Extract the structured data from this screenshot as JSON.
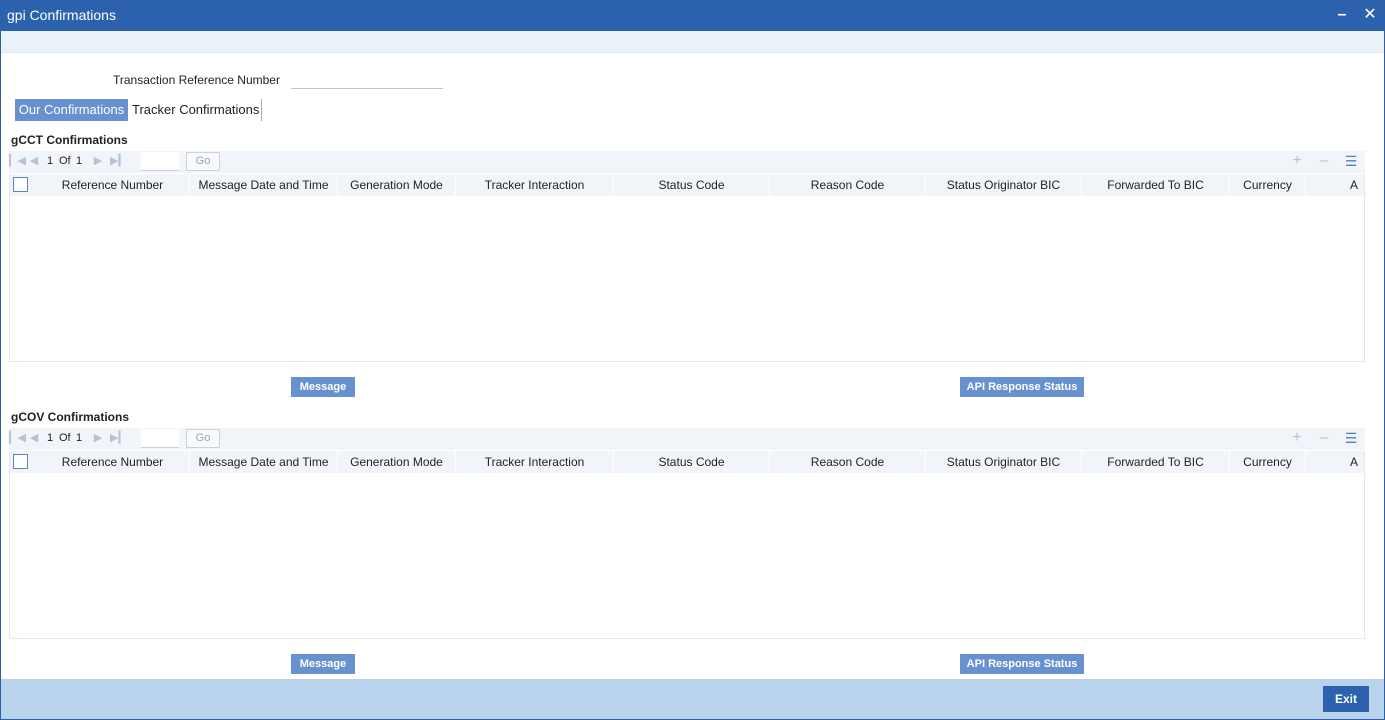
{
  "window": {
    "title": "gpi Confirmations",
    "minimize_symbol": "–",
    "close_symbol": "✕"
  },
  "form": {
    "transaction_reference_label": "Transaction Reference Number",
    "transaction_reference_value": ""
  },
  "tabs": [
    {
      "label": "Our Confirmations",
      "active": true
    },
    {
      "label": "Tracker Confirmations",
      "active": false
    }
  ],
  "columns": [
    "Reference Number",
    "Message Date and Time",
    "Generation Mode",
    "Tracker Interaction",
    "Status Code",
    "Reason Code",
    "Status Originator BIC",
    "Forwarded To BIC",
    "Currency",
    "A"
  ],
  "sections": {
    "gcct": {
      "title": "gCCT Confirmations",
      "pager": {
        "current": "1",
        "of_label": "Of",
        "total": "1",
        "go_label": "Go"
      },
      "message_button": "Message",
      "api_button": "API Response Status"
    },
    "gcov": {
      "title": "gCOV Confirmations",
      "pager": {
        "current": "1",
        "of_label": "Of",
        "total": "1",
        "go_label": "Go"
      },
      "message_button": "Message",
      "api_button": "API Response Status"
    }
  },
  "icons": {
    "first_page": "first-page-icon",
    "prev_page": "previous-page-icon",
    "next_page": "next-page-icon",
    "last_page": "last-page-icon",
    "add_row": "add-row-icon",
    "delete_row": "delete-row-icon",
    "single_view": "list-view-icon"
  },
  "footer": {
    "exit_label": "Exit"
  },
  "colors": {
    "title_bar": "#2c62ad",
    "accent_button": "#6792cf",
    "footer": "#b9d3ec"
  }
}
